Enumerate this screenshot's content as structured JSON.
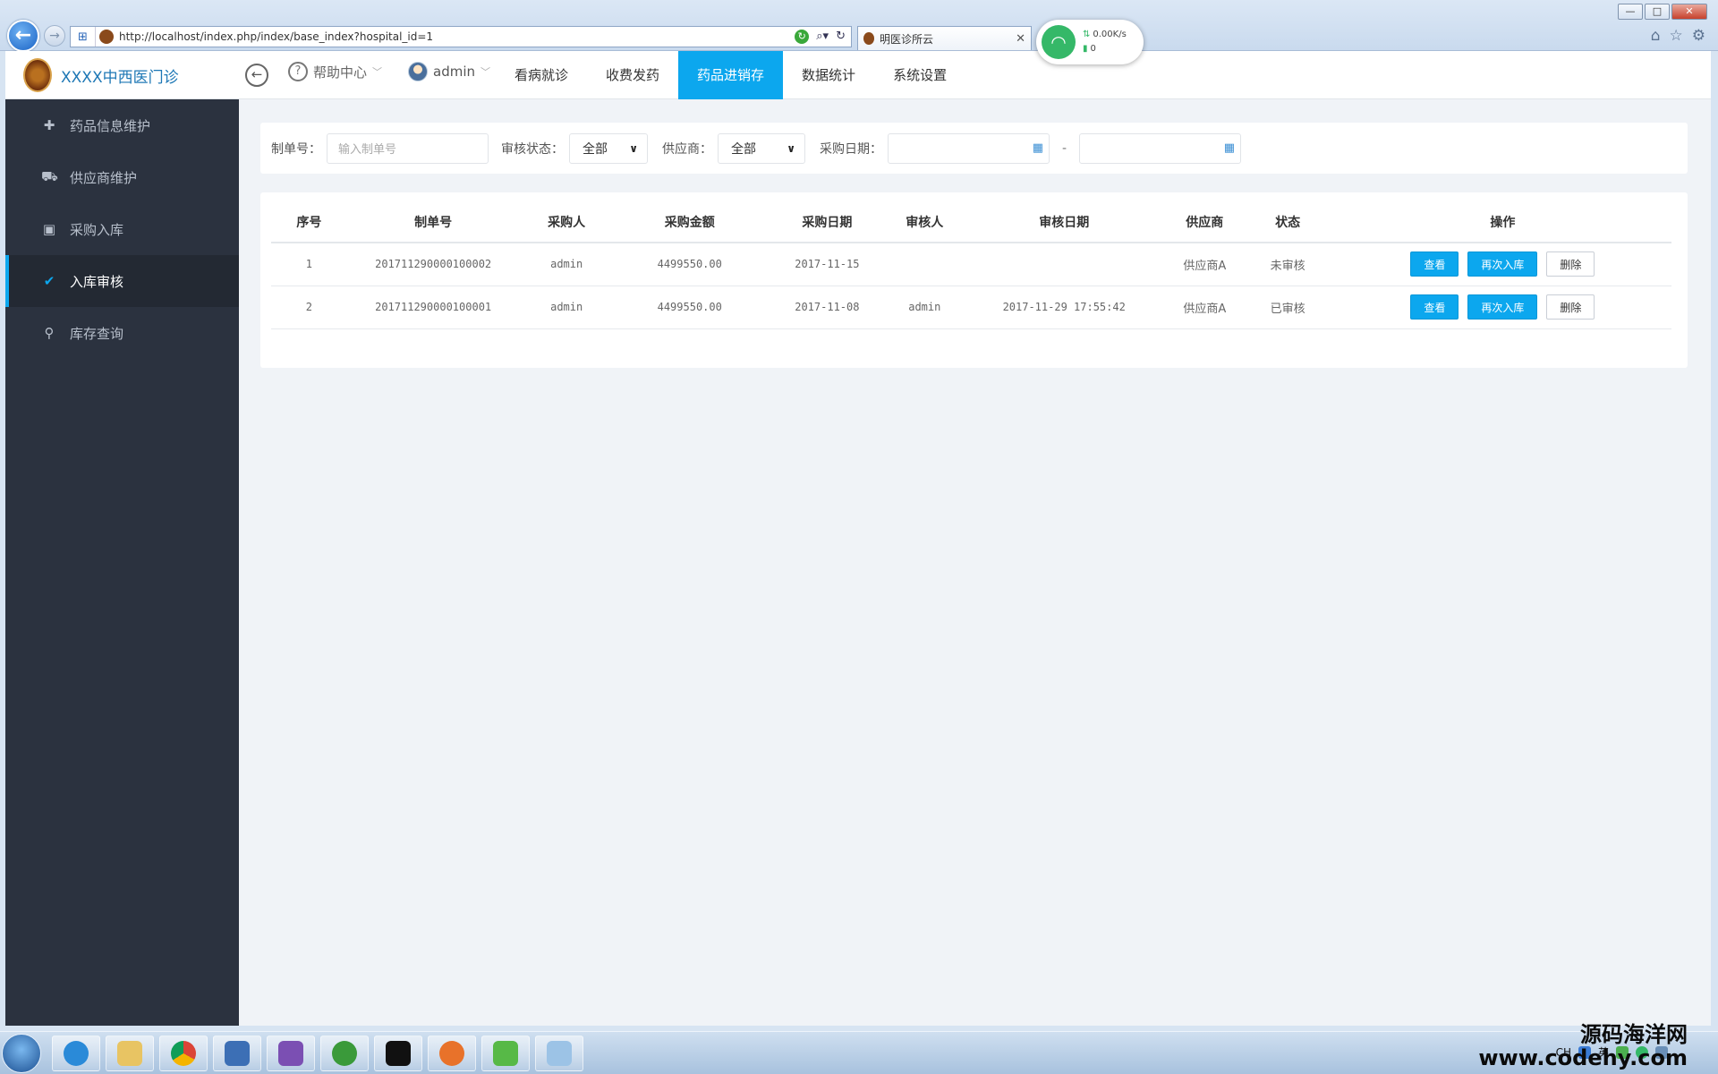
{
  "browser": {
    "url": "http://localhost/index.php/index/base_index?hospital_id=1",
    "tab_title": "明医诊所云",
    "net_speed": "0.00K/s",
    "net_count": "0",
    "window_buttons": [
      "—",
      "□",
      "✕"
    ]
  },
  "header": {
    "app_name": "XXXX中西医门诊",
    "help_label": "帮助中心",
    "user_label": "admin",
    "menu": [
      {
        "label": "看病就诊"
      },
      {
        "label": "收费发药"
      },
      {
        "label": "药品进销存",
        "active": true
      },
      {
        "label": "数据统计"
      },
      {
        "label": "系统设置"
      }
    ]
  },
  "sidebar": {
    "items": [
      {
        "label": "药品信息维护",
        "icon": "medkit-icon"
      },
      {
        "label": "供应商维护",
        "icon": "ambulance-icon"
      },
      {
        "label": "采购入库",
        "icon": "cart-icon"
      },
      {
        "label": "入库审核",
        "icon": "check-icon",
        "active": true
      },
      {
        "label": "库存查询",
        "icon": "search-icon"
      }
    ]
  },
  "filters": {
    "order_no_label": "制单号：",
    "order_no_placeholder": "输入制单号",
    "audit_status_label": "审核状态：",
    "audit_status_value": "全部",
    "supplier_label": "供应商：",
    "supplier_value": "全部",
    "purchase_date_label": "采购日期：",
    "date_separator": "-"
  },
  "table": {
    "headers": [
      "序号",
      "制单号",
      "采购人",
      "采购金额",
      "采购日期",
      "审核人",
      "审核日期",
      "供应商",
      "状态",
      "操作"
    ],
    "rows": [
      {
        "index": "1",
        "order_no": "201711290000100002",
        "buyer": "admin",
        "amount": "4499550.00",
        "date": "2017-11-15",
        "auditor": "",
        "audit_date": "",
        "supplier": "供应商A",
        "status": "未审核"
      },
      {
        "index": "2",
        "order_no": "201711290000100001",
        "buyer": "admin",
        "amount": "4499550.00",
        "date": "2017-11-08",
        "auditor": "admin",
        "audit_date": "2017-11-29 17:55:42",
        "supplier": "供应商A",
        "status": "已审核"
      }
    ],
    "actions": {
      "view": "查看",
      "restock": "再次入库",
      "delete": "删除"
    }
  },
  "taskbar": {
    "tray_lang": "CH",
    "tray_ime": "英"
  },
  "watermark": {
    "line1": "源码海洋网",
    "line2": "www.codehy.com"
  },
  "colors": {
    "accent": "#0ca7ee",
    "sidebar_bg": "#2b323f",
    "content_bg": "#f0f3f7"
  }
}
